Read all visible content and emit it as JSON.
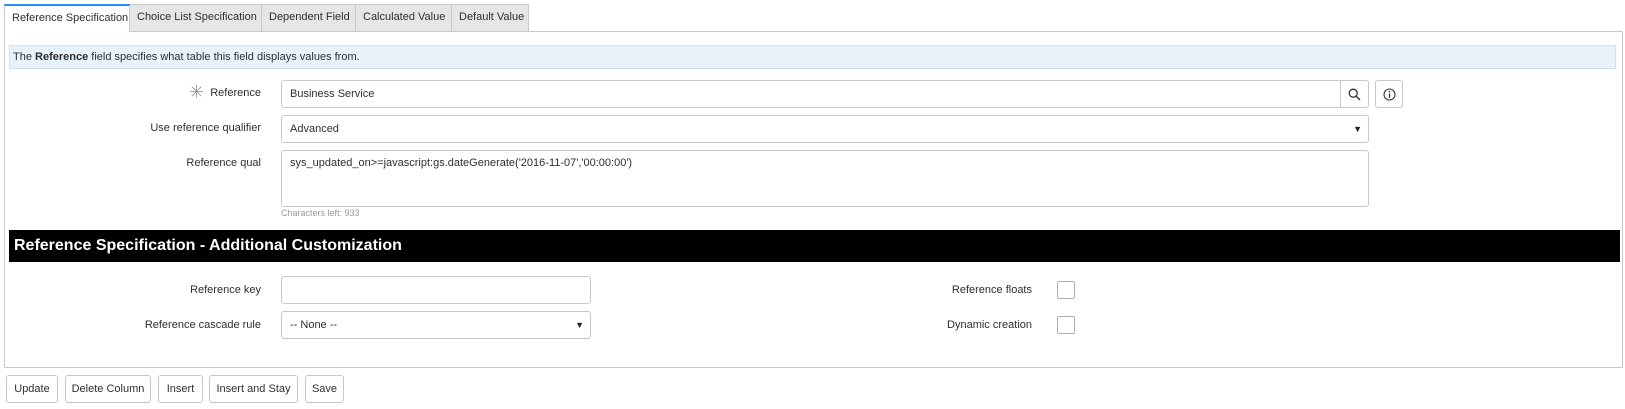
{
  "tabs": [
    {
      "label": "Reference Specification",
      "active": true
    },
    {
      "label": "Choice List Specification",
      "active": false
    },
    {
      "label": "Dependent Field",
      "active": false
    },
    {
      "label": "Calculated Value",
      "active": false
    },
    {
      "label": "Default Value",
      "active": false
    }
  ],
  "info": {
    "prefix": "The ",
    "strong": "Reference",
    "suffix": " field specifies what table this field displays values from."
  },
  "form": {
    "reference": {
      "label": "Reference",
      "value": "Business Service",
      "required_mark": "✳",
      "lookup_icon": "search-icon",
      "info_icon": "info-icon"
    },
    "use_ref_qualifier": {
      "label": "Use reference qualifier",
      "value": "Advanced"
    },
    "reference_qual": {
      "label": "Reference qual",
      "value": "sys_updated_on>=javascript:gs.dateGenerate('2016-11-07','00:00:00')",
      "hint": "Characters left: 933"
    }
  },
  "section": {
    "title": "Reference Specification - Additional Customization",
    "reference_key": {
      "label": "Reference key",
      "value": ""
    },
    "cascade_rule": {
      "label": "Reference cascade rule",
      "value": "-- None --"
    },
    "reference_floats": {
      "label": "Reference floats",
      "checked": false
    },
    "dynamic_creation": {
      "label": "Dynamic creation",
      "checked": false
    }
  },
  "buttons": {
    "update": "Update",
    "delete_column": "Delete Column",
    "insert": "Insert",
    "insert_and_stay": "Insert and Stay",
    "save": "Save"
  },
  "colors": {
    "active_tab_accent": "#278efc",
    "info_bg": "#e8f2fb",
    "section_bg": "#000000"
  }
}
